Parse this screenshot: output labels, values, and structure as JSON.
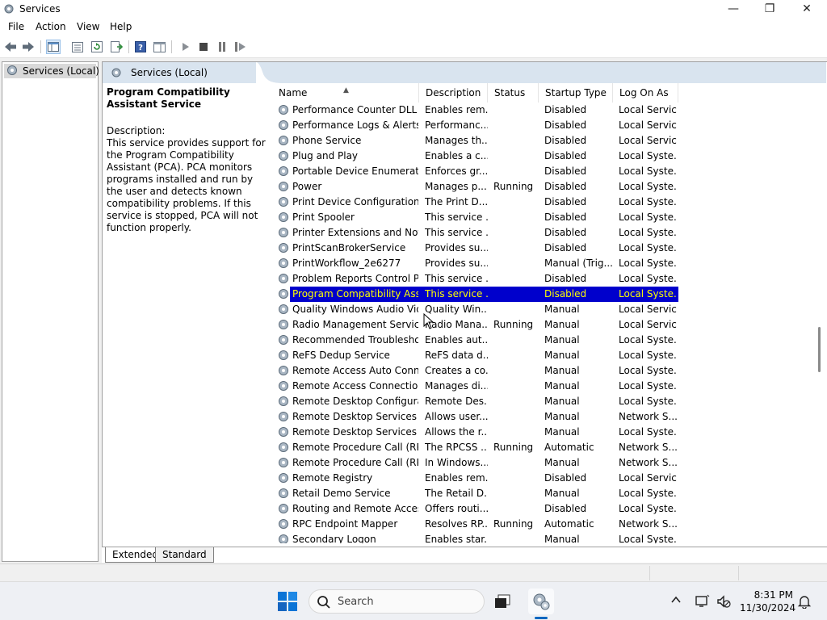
{
  "window": {
    "title": "Services",
    "minimize_glyph": "—",
    "restore_glyph": "❐",
    "close_glyph": "✕"
  },
  "menu": {
    "file": "File",
    "action": "Action",
    "view": "View",
    "help": "Help"
  },
  "tree": {
    "root_label": "Services (Local)"
  },
  "main": {
    "header_title": "Services (Local)"
  },
  "description_pane": {
    "service_title": "Program Compatibility Assistant Service",
    "description_label": "Description:",
    "description_text": "This service provides support for the Program Compatibility Assistant (PCA).  PCA monitors programs installed and run by the user and detects known compatibility problems. If this service is stopped, PCA will not function properly."
  },
  "services": {
    "columns": {
      "name": "Name",
      "description": "Description",
      "status": "Status",
      "startup": "Startup Type",
      "logon": "Log On As"
    },
    "rows": [
      {
        "name": "Performance Counter DLL ...",
        "description": "Enables rem...",
        "status": "",
        "startup": "Disabled",
        "logon": "Local Service"
      },
      {
        "name": "Performance Logs & Alerts",
        "description": "Performanc...",
        "status": "",
        "startup": "Disabled",
        "logon": "Local Service"
      },
      {
        "name": "Phone Service",
        "description": "Manages th...",
        "status": "",
        "startup": "Disabled",
        "logon": "Local Service"
      },
      {
        "name": "Plug and Play",
        "description": "Enables a c...",
        "status": "",
        "startup": "Disabled",
        "logon": "Local Syste..."
      },
      {
        "name": "Portable Device Enumerator...",
        "description": "Enforces gr...",
        "status": "",
        "startup": "Disabled",
        "logon": "Local Syste..."
      },
      {
        "name": "Power",
        "description": "Manages p...",
        "status": "Running",
        "startup": "Disabled",
        "logon": "Local Syste..."
      },
      {
        "name": "Print Device Configuration ...",
        "description": "The Print D...",
        "status": "",
        "startup": "Disabled",
        "logon": "Local Syste..."
      },
      {
        "name": "Print Spooler",
        "description": "This service ...",
        "status": "",
        "startup": "Disabled",
        "logon": "Local Syste..."
      },
      {
        "name": "Printer Extensions and Notif...",
        "description": "This service ...",
        "status": "",
        "startup": "Disabled",
        "logon": "Local Syste..."
      },
      {
        "name": "PrintScanBrokerService",
        "description": "Provides su...",
        "status": "",
        "startup": "Disabled",
        "logon": "Local Syste..."
      },
      {
        "name": "PrintWorkflow_2e6277",
        "description": "Provides su...",
        "status": "",
        "startup": "Manual (Trig...",
        "logon": "Local Syste..."
      },
      {
        "name": "Problem Reports Control Pa...",
        "description": "This service ...",
        "status": "",
        "startup": "Disabled",
        "logon": "Local Syste..."
      },
      {
        "name": "Program Compatibility Assi...",
        "description": "This service ...",
        "status": "",
        "startup": "Disabled",
        "logon": "Local Syste...",
        "selected": true
      },
      {
        "name": "Quality Windows Audio Vid...",
        "description": "Quality Win...",
        "status": "",
        "startup": "Manual",
        "logon": "Local Service"
      },
      {
        "name": "Radio Management Service",
        "description": "Radio Mana...",
        "status": "Running",
        "startup": "Manual",
        "logon": "Local Service"
      },
      {
        "name": "Recommended Troublesho...",
        "description": "Enables aut...",
        "status": "",
        "startup": "Manual",
        "logon": "Local Syste..."
      },
      {
        "name": "ReFS Dedup Service",
        "description": "ReFS data d...",
        "status": "",
        "startup": "Manual",
        "logon": "Local Syste..."
      },
      {
        "name": "Remote Access Auto Conne...",
        "description": "Creates a co...",
        "status": "",
        "startup": "Manual",
        "logon": "Local Syste..."
      },
      {
        "name": "Remote Access Connection...",
        "description": "Manages di...",
        "status": "",
        "startup": "Manual",
        "logon": "Local Syste..."
      },
      {
        "name": "Remote Desktop Configurat...",
        "description": "Remote Des...",
        "status": "",
        "startup": "Manual",
        "logon": "Local Syste..."
      },
      {
        "name": "Remote Desktop Services",
        "description": "Allows user...",
        "status": "",
        "startup": "Manual",
        "logon": "Network S..."
      },
      {
        "name": "Remote Desktop Services U...",
        "description": "Allows the r...",
        "status": "",
        "startup": "Manual",
        "logon": "Local Syste..."
      },
      {
        "name": "Remote Procedure Call (RPC)",
        "description": "The RPCSS ...",
        "status": "Running",
        "startup": "Automatic",
        "logon": "Network S..."
      },
      {
        "name": "Remote Procedure Call (RP...",
        "description": "In Windows...",
        "status": "",
        "startup": "Manual",
        "logon": "Network S..."
      },
      {
        "name": "Remote Registry",
        "description": "Enables rem...",
        "status": "",
        "startup": "Disabled",
        "logon": "Local Service"
      },
      {
        "name": "Retail Demo Service",
        "description": "The Retail D...",
        "status": "",
        "startup": "Manual",
        "logon": "Local Syste..."
      },
      {
        "name": "Routing and Remote Access",
        "description": "Offers routi...",
        "status": "",
        "startup": "Disabled",
        "logon": "Local Syste..."
      },
      {
        "name": "RPC Endpoint Mapper",
        "description": "Resolves RP...",
        "status": "Running",
        "startup": "Automatic",
        "logon": "Network S..."
      },
      {
        "name": "Secondary Logon",
        "description": "Enables star...",
        "status": "",
        "startup": "Manual",
        "logon": "Local Syste..."
      }
    ]
  },
  "tabs": {
    "extended": "Extended",
    "standard": "Standard"
  },
  "taskbar": {
    "search_placeholder": "Search",
    "time": "8:31 PM",
    "date": "11/30/2024"
  },
  "colors": {
    "selection_bg": "#0000cc",
    "selection_text": "#ffff00",
    "header_band": "#d9e4ef",
    "accent": "#0067c0"
  }
}
